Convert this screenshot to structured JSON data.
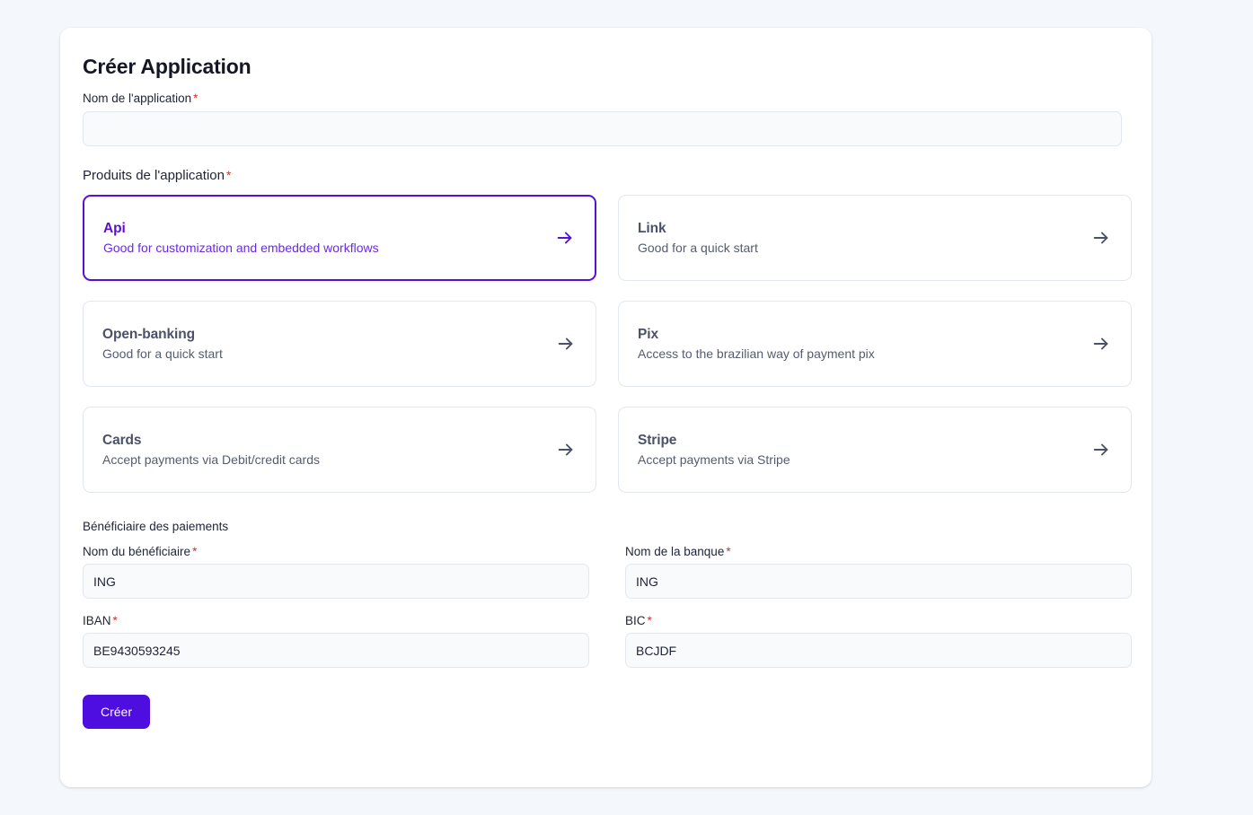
{
  "page": {
    "title": "Créer Application",
    "background_color": "#f4f7fb",
    "accent_color": "#5b0fd6",
    "required_marker": "*"
  },
  "app_name_field": {
    "label": "Nom de l'application",
    "required_marker": "*",
    "value": "",
    "placeholder": ""
  },
  "products_section": {
    "label": "Produits de l'application",
    "required_marker": "*",
    "arrow_icon": "arrow-right-icon",
    "items": [
      {
        "name": "Api",
        "description": "Good for customization and embedded workflows",
        "selected": true
      },
      {
        "name": "Link",
        "description": "Good for a quick start",
        "selected": false
      },
      {
        "name": "Open-banking",
        "description": "Good for a quick start",
        "selected": false
      },
      {
        "name": "Pix",
        "description": "Access to the brazilian way of payment pix",
        "selected": false
      },
      {
        "name": "Cards",
        "description": "Accept payments via Debit/credit cards",
        "selected": false
      },
      {
        "name": "Stripe",
        "description": "Accept payments via Stripe",
        "selected": false
      }
    ]
  },
  "beneficiary_section": {
    "title": "Bénéficiaire des paiements",
    "fields": [
      {
        "label": "Nom du bénéficiaire",
        "required_marker": "*",
        "value": "ING",
        "placeholder": ""
      },
      {
        "label": "Nom de la banque",
        "required_marker": "*",
        "value": "ING",
        "placeholder": ""
      },
      {
        "label": "IBAN",
        "required_marker": "*",
        "value": "BE9430593245",
        "placeholder": ""
      },
      {
        "label": "BIC",
        "required_marker": "*",
        "value": "BCJDF",
        "placeholder": ""
      }
    ]
  },
  "submit_button": {
    "label": "Créer"
  }
}
